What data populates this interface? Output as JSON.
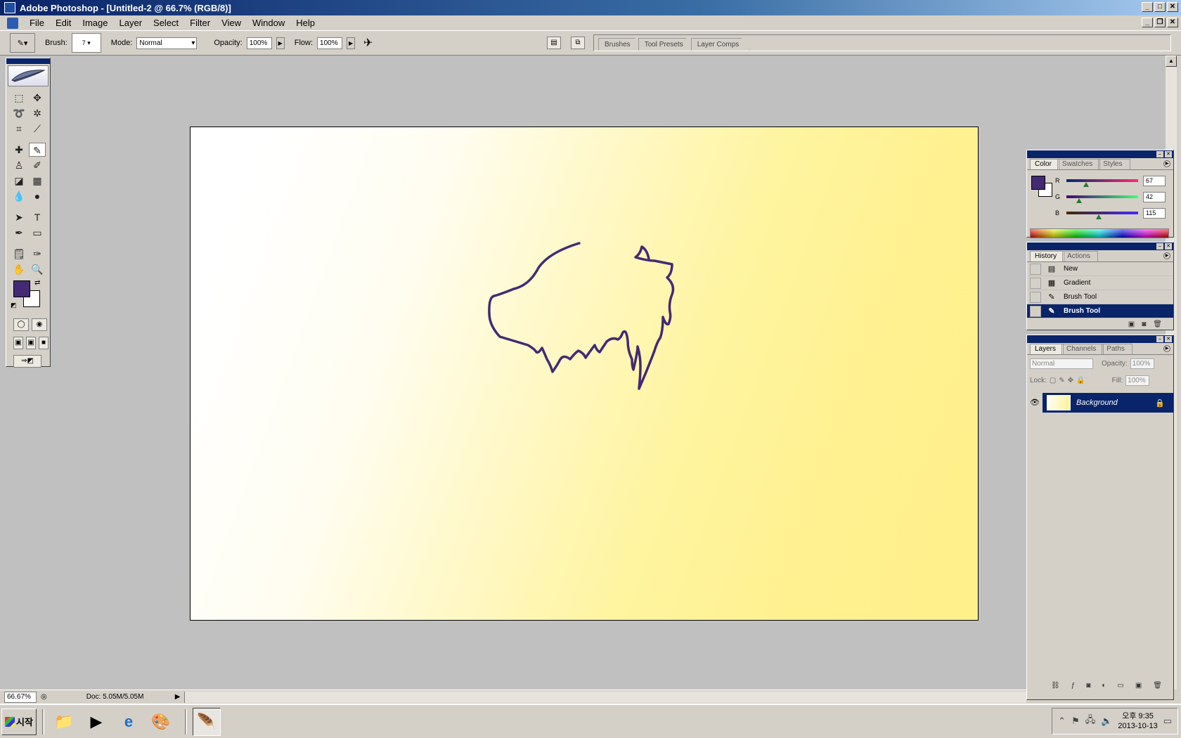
{
  "window": {
    "title": "Adobe Photoshop - [Untitled-2 @ 66.7% (RGB/8)]"
  },
  "menu": [
    "File",
    "Edit",
    "Image",
    "Layer",
    "Select",
    "Filter",
    "View",
    "Window",
    "Help"
  ],
  "options": {
    "brush_label": "Brush:",
    "brush_size": "7",
    "mode_label": "Mode:",
    "mode_value": "Normal",
    "opacity_label": "Opacity:",
    "opacity_value": "100%",
    "flow_label": "Flow:",
    "flow_value": "100%"
  },
  "well_tabs": [
    "Brushes",
    "Tool Presets",
    "Layer Comps"
  ],
  "color_panel": {
    "tabs": [
      "Color",
      "Swatches",
      "Styles"
    ],
    "foreground": "#432a73",
    "background": "#ffffff",
    "r_label": "R",
    "r_value": "67",
    "g_label": "G",
    "g_value": "42",
    "b_label": "B",
    "b_value": "115"
  },
  "history_panel": {
    "tabs": [
      "History",
      "Actions"
    ],
    "items": [
      "New",
      "Gradient",
      "Brush Tool",
      "Brush Tool"
    ]
  },
  "layers_panel": {
    "tabs": [
      "Layers",
      "Channels",
      "Paths"
    ],
    "blend_mode": "Normal",
    "opacity_label": "Opacity:",
    "opacity_value": "100%",
    "lock_label": "Lock:",
    "fill_label": "Fill:",
    "fill_value": "100%",
    "layer_name": "Background"
  },
  "status": {
    "zoom": "66.67%",
    "doc": "Doc: 5.05M/5.05M"
  },
  "taskbar": {
    "start": "시작",
    "time": "오후 9:35",
    "date": "2013-10-13"
  },
  "colors": {
    "accent": "#0a246a",
    "stroke": "#432a73"
  }
}
